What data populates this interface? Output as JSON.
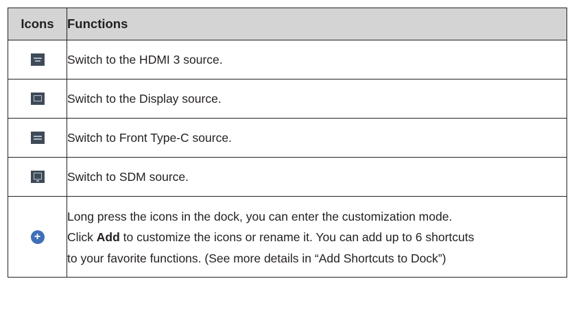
{
  "table": {
    "headers": {
      "icons": "Icons",
      "functions": "Functions"
    },
    "rows": [
      {
        "icon": "hdmi-source-icon",
        "function": "Switch to the HDMI 3 source."
      },
      {
        "icon": "display-source-icon",
        "function": "Switch to the Display source."
      },
      {
        "icon": "type-c-source-icon",
        "function": "Switch to Front Type-C source."
      },
      {
        "icon": "sdm-source-icon",
        "function": "Switch to SDM source."
      },
      {
        "icon": "add-icon",
        "function_lines": {
          "line1": "Long press the icons in the dock, you can enter the customization mode.",
          "line2_pre": "Click ",
          "line2_bold": "Add",
          "line2_post": " to customize the icons or rename it. You can add up to 6 shortcuts",
          "line3": "to your favorite functions. (See more details in “Add Shortcuts to Dock”)"
        }
      }
    ]
  },
  "colors": {
    "header_bg": "#d4d4d4",
    "icon_bg": "#3e4a57",
    "add_icon_bg": "#3f6fb8",
    "border": "#231f20"
  }
}
